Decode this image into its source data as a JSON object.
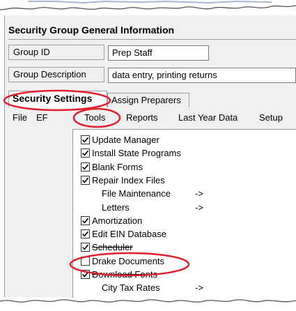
{
  "group_info": {
    "title": "Security Group General Information",
    "group_id_label": "Group ID",
    "group_id_value": "Prep Staff",
    "group_desc_label": "Group Description",
    "group_desc_value": "data entry, printing returns"
  },
  "tabs": [
    "Security Settings",
    "Assign Preparers"
  ],
  "menubar": [
    "File",
    "EF",
    "Tools",
    "Reports",
    "Last Year Data",
    "Setup"
  ],
  "tools_menu": {
    "items": [
      {
        "label": "Update Manager",
        "checked": true
      },
      {
        "label": "Install State Programs",
        "checked": true
      },
      {
        "label": "Blank Forms",
        "checked": true
      },
      {
        "label": "Repair Index Files",
        "checked": true
      },
      {
        "label": "File Maintenance",
        "submenu": "->"
      },
      {
        "label": "Letters",
        "submenu": "->"
      },
      {
        "label": "Amortization",
        "checked": true
      },
      {
        "label": "Edit EIN Database",
        "checked": true
      },
      {
        "label": "Scheduler",
        "checked": true
      },
      {
        "label": "Drake Documents",
        "checked": false
      },
      {
        "label": "Download Fonts",
        "checked": true
      },
      {
        "label": "City Tax Rates",
        "submenu": "->"
      }
    ]
  },
  "colors": {
    "annotation": "#e0202a",
    "panel": "#f0f0f0"
  }
}
